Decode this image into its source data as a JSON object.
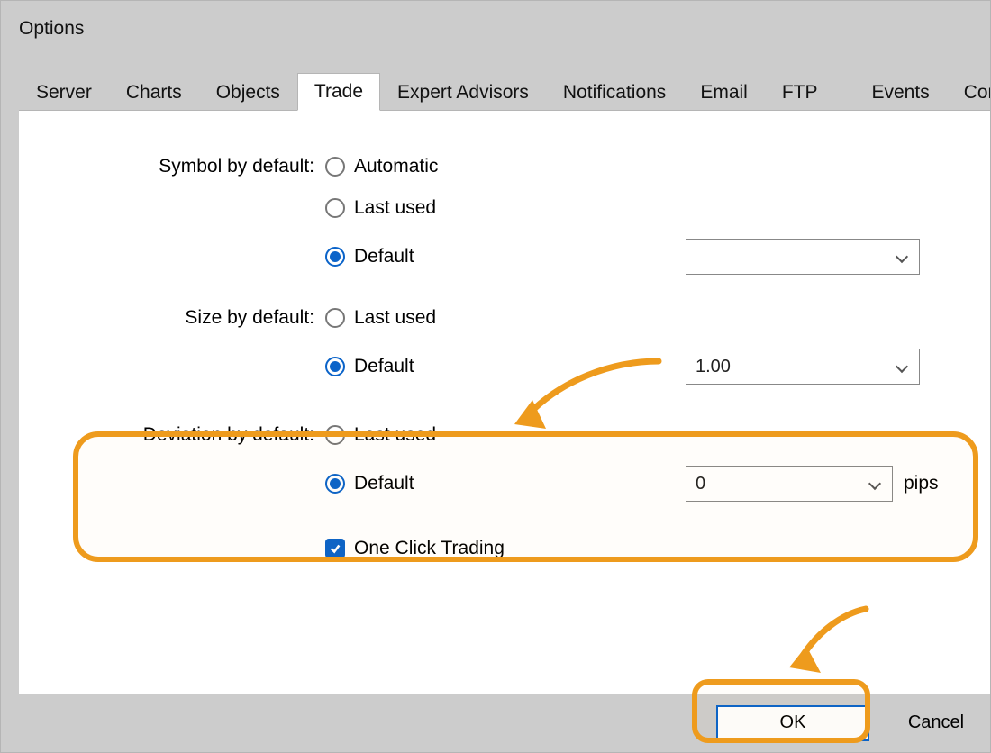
{
  "window": {
    "title": "Options"
  },
  "tabs": {
    "items": [
      {
        "label": "Server"
      },
      {
        "label": "Charts"
      },
      {
        "label": "Objects"
      },
      {
        "label": "Trade"
      },
      {
        "label": "Expert Advisors"
      },
      {
        "label": "Notifications"
      },
      {
        "label": "Email"
      },
      {
        "label": "FTP"
      },
      {
        "label": "Events"
      },
      {
        "label": "Com"
      }
    ],
    "active_index": 3
  },
  "form": {
    "symbol_label": "Symbol by default:",
    "symbol": {
      "automatic": "Automatic",
      "last": "Last used",
      "def": "Default",
      "value": ""
    },
    "size_label": "Size by default:",
    "size": {
      "last": "Last used",
      "def": "Default",
      "value": "1.00"
    },
    "deviation_label": "Deviation by default:",
    "deviation": {
      "last": "Last used",
      "def": "Default",
      "value": "0",
      "unit": "pips"
    },
    "oct": {
      "label": "One Click Trading",
      "checked": true
    }
  },
  "buttons": {
    "ok": "OK",
    "cancel": "Cancel"
  },
  "colors": {
    "accent": "#0a63c9",
    "highlight": "#ee9b1d"
  }
}
